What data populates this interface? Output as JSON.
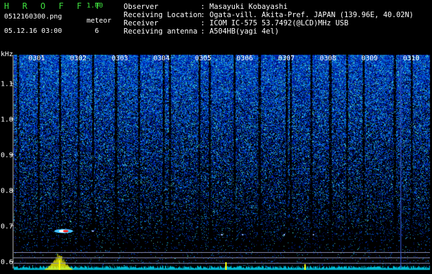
{
  "header": {
    "app_title": "H R O F F T",
    "version": "1.00",
    "file_name": "0512160300.png",
    "meteor_label": "meteor",
    "date_time": "05.12.16 03:00",
    "meteor_count": "6"
  },
  "info": [
    {
      "label": "Observer",
      "value": "Masayuki Kobayashi"
    },
    {
      "label": "Receiving Location",
      "value": "Ogata-vill. Akita-Pref. JAPAN (139.96E, 40.02N)"
    },
    {
      "label": "Receiver",
      "value": "ICOM IC-575 53.7492(@LCD)MHz USB"
    },
    {
      "label": "Receiving antenna",
      "value": "A504HB(yagi 4el)"
    }
  ],
  "colors": {
    "text_green": "#3fe03f",
    "text_white": "#ffffff",
    "background": "#000000",
    "spectrum": "#00bcd4",
    "peak": "#ffff00",
    "echo": "#ff3030"
  },
  "chart_data": {
    "type": "heatmap",
    "title": "",
    "y_unit_label": "kHz",
    "x_tick_labels": [
      "0301",
      "0302",
      "0303",
      "0304",
      "0305",
      "0306",
      "0307",
      "0308",
      "0309",
      "0310"
    ],
    "y_tick_labels": [
      "1.1",
      "1.0",
      "0.9",
      "0.8",
      "0.7",
      "0.6"
    ],
    "y_ticks": [
      1.1,
      1.0,
      0.9,
      0.8,
      0.7,
      0.6
    ],
    "ylim": [
      0.58,
      1.18
    ],
    "xlim_minutes": [
      0,
      10
    ],
    "reference_lines_khz": [
      0.625,
      0.61,
      0.595
    ],
    "meteor_echoes": [
      {
        "time_min": 1.2,
        "freq_khz": 0.685,
        "duration_min": 0.45,
        "intensity": "strong"
      },
      {
        "time_min": 5.0,
        "freq_khz": 0.675,
        "duration_min": 0.05,
        "intensity": "weak"
      },
      {
        "time_min": 5.5,
        "freq_khz": 0.675,
        "duration_min": 0.03,
        "intensity": "weak"
      },
      {
        "time_min": 6.5,
        "freq_khz": 0.675,
        "duration_min": 0.04,
        "intensity": "weak"
      },
      {
        "time_min": 7.2,
        "freq_khz": 0.675,
        "duration_min": 0.03,
        "intensity": "weak"
      },
      {
        "time_min": 1.9,
        "freq_khz": 0.685,
        "duration_min": 0.05,
        "intensity": "weak"
      }
    ],
    "signal_spikes": [
      {
        "time_min": 1.1,
        "level": 1.0
      },
      {
        "time_min": 5.1,
        "level": 0.8
      },
      {
        "time_min": 7.0,
        "level": 0.6
      }
    ],
    "dark_gap_minutes": [
      0.1,
      0.6,
      1.1,
      1.55,
      1.9,
      2.45,
      3.0,
      3.6,
      3.75,
      4.45,
      4.7,
      5.3,
      5.9,
      6.55,
      6.65,
      7.15,
      7.6,
      8.0,
      8.4,
      9.15,
      9.55
    ],
    "vertical_line_minute": 9.3
  }
}
